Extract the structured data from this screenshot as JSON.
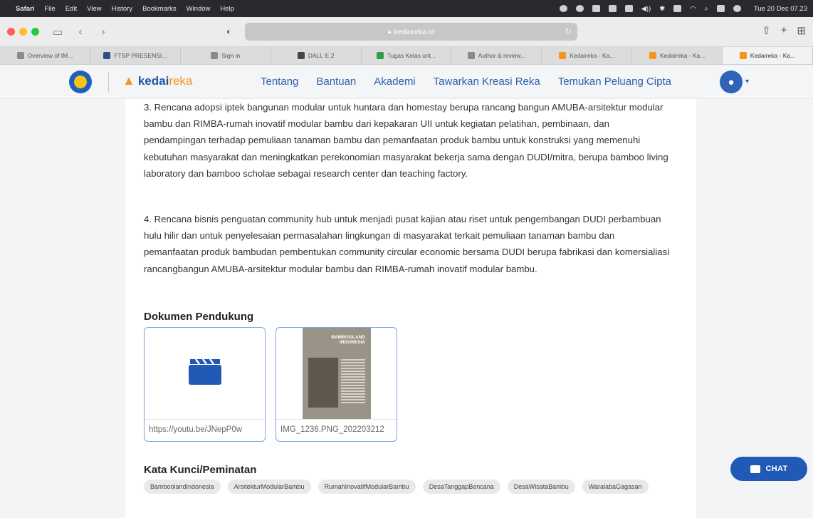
{
  "menubar": {
    "app": "Safari",
    "items": [
      "File",
      "Edit",
      "View",
      "History",
      "Bookmarks",
      "Window",
      "Help"
    ],
    "clock": "Tue 20 Dec 07.23"
  },
  "browser": {
    "url": "kedaireka.id",
    "tabs": [
      {
        "label": "Overview of IM...",
        "color": "#8a8a8a"
      },
      {
        "label": "FTSP PRESENSI...",
        "color": "#2c4f8f"
      },
      {
        "label": "Sign in",
        "color": "#8a8a8a"
      },
      {
        "label": "DALL·E 2",
        "color": "#444444"
      },
      {
        "label": "Tugas Kelas unt...",
        "color": "#2f9e44"
      },
      {
        "label": "Author & review...",
        "color": "#8a8a8a"
      },
      {
        "label": "Kedaireka - Ka...",
        "color": "#f7941d"
      },
      {
        "label": "Kedaireka - Ka...",
        "color": "#f7941d"
      },
      {
        "label": "Kedaireka - Ka...",
        "color": "#f7941d"
      }
    ]
  },
  "header": {
    "brand_part1": "kedai",
    "brand_part2": "reka",
    "nav": [
      "Tentang",
      "Bantuan",
      "Akademi",
      "Tawarkan Kreasi Reka",
      "Temukan Peluang Cipta"
    ]
  },
  "content": {
    "para1": "3.   Rencana adopsi iptek bangunan modular untuk huntara dan homestay berupa rancang bangun AMUBA-arsitektur modular bambu dan RIMBA-rumah inovatif modular bambu dari kepakaran UII untuk kegiatan pelatihan, pembinaan, dan pendampingan terhadap pemuliaan tanaman bambu dan pemanfaatan produk bambu untuk konstruksi yang memenuhi kebutuhan masyarakat dan meningkatkan perekonomian masyarakat bekerja sama dengan DUDI/mitra, berupa bamboo living laboratory dan bamboo scholae sebagai research center dan teaching factory.",
    "para2": "4.   Rencana bisnis penguatan community hub untuk menjadi pusat kajian atau riset untuk pengembangan DUDI perbambuan hulu hilir dan untuk penyelesaian permasalahan lingkungan di masyarakat terkait pemuliaan tanaman bambu dan pemanfaatan produk bambudan pembentukan community circular economic bersama DUDI berupa fabrikasi dan komersialiasi rancangbangun AMUBA-arsitektur modular bambu dan RIMBA-rumah inovatif modular bambu.",
    "docs_title": "Dokumen Pendukung",
    "docs": [
      {
        "caption": "https://youtu.be/JNepP0w",
        "icon": "video-clapper-icon"
      },
      {
        "caption": "IMG_1236.PNG_202203212",
        "magazine_title": "BAMBOOLAND INDONESIA"
      }
    ],
    "keywords_title": "Kata Kunci/Peminatan",
    "keywords": [
      "BamboolandIndonesia",
      "ArsitekturModularBambu",
      "RumahInovatifModularBambu",
      "DesaTanggapBencana",
      "DesaWisataBambu",
      "WaralabaGagasan"
    ]
  },
  "chat": {
    "label": "CHAT"
  },
  "colors": {
    "brand_blue": "#2159b6",
    "brand_orange": "#f7941d"
  }
}
